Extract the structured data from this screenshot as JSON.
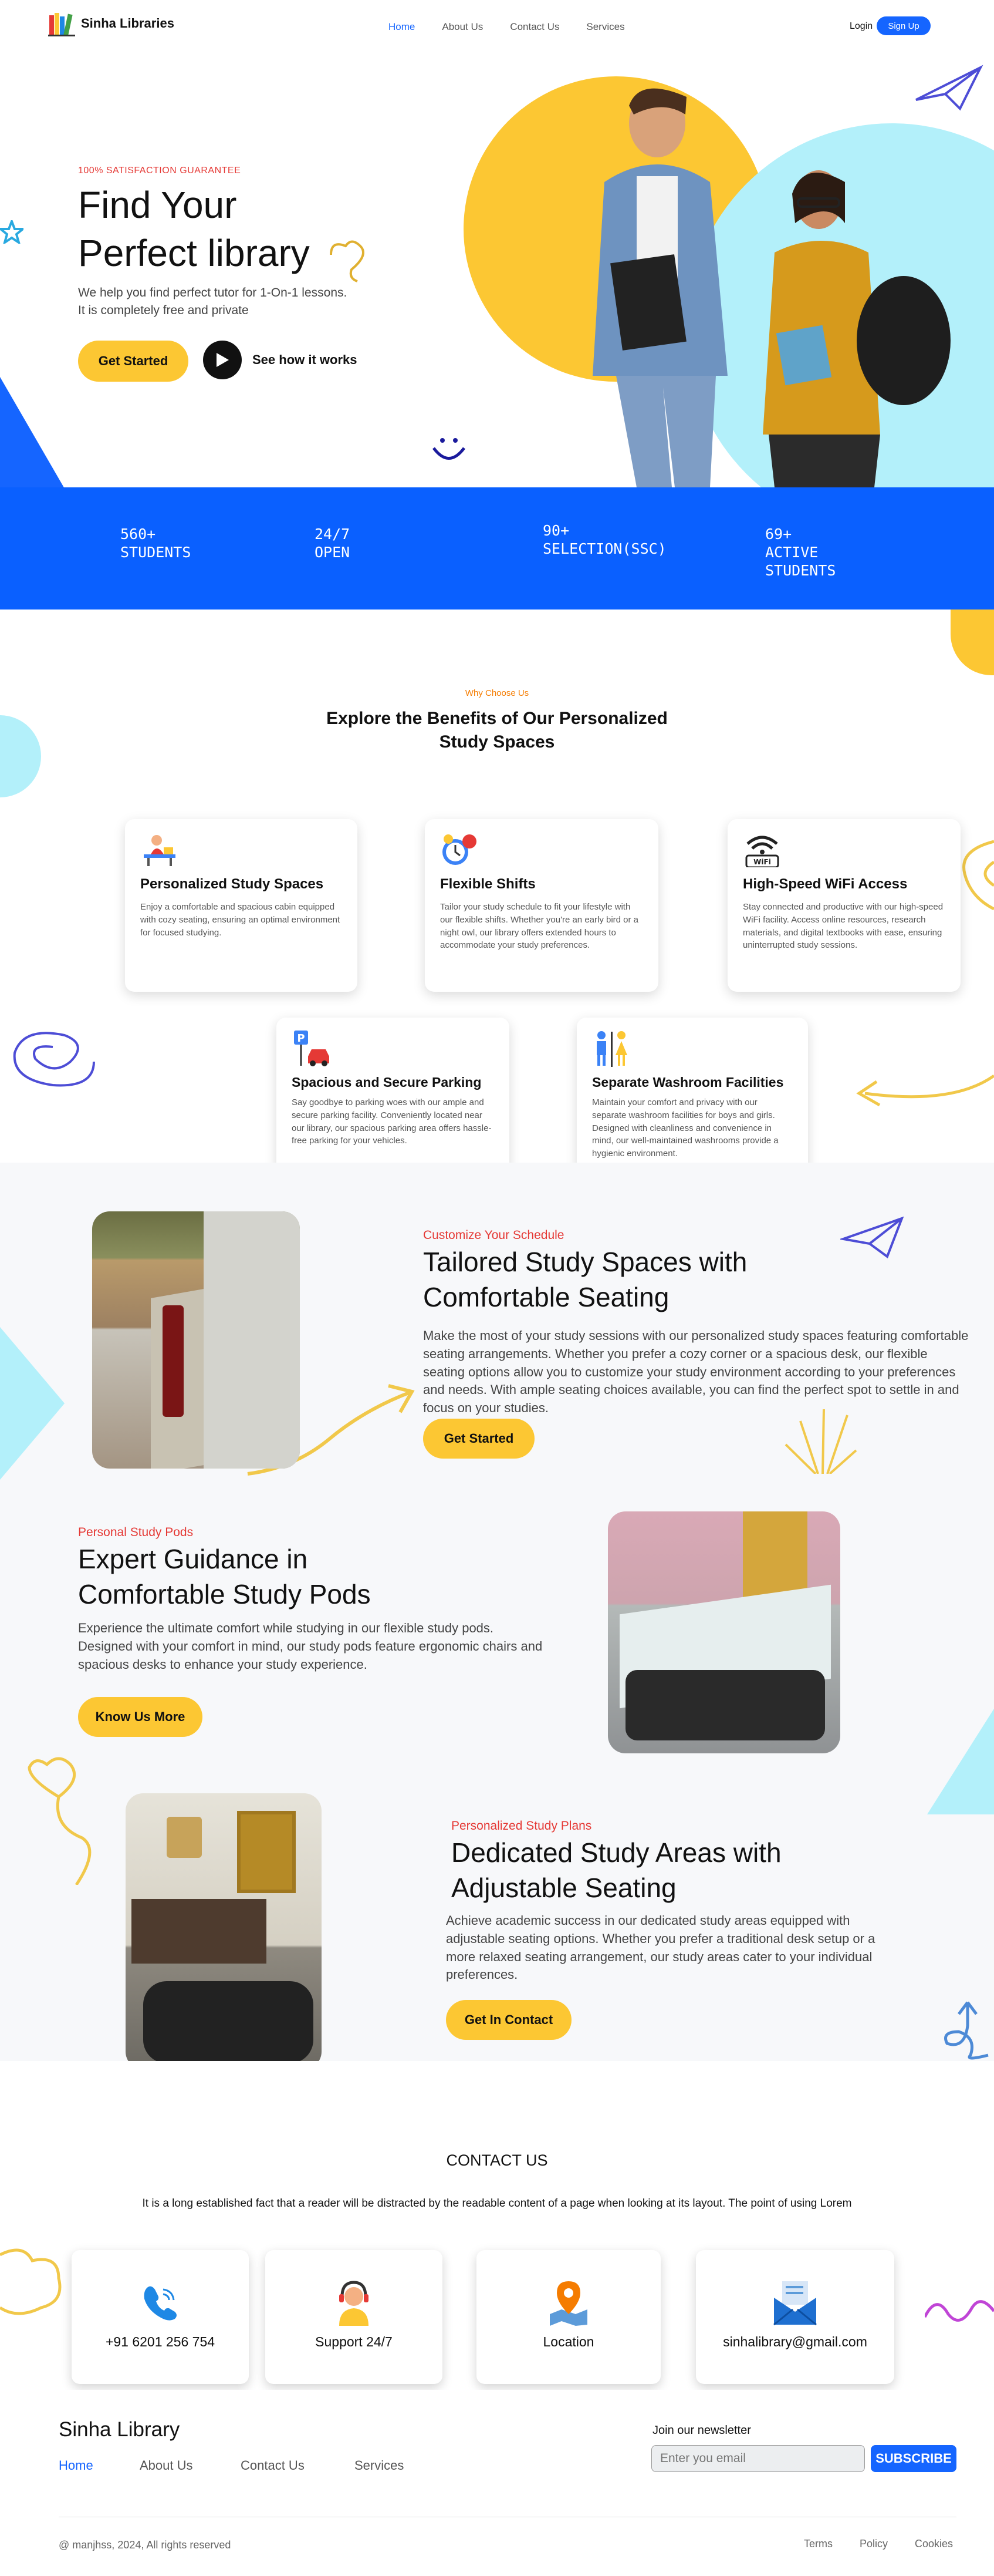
{
  "colors": {
    "accent": "#1565ff",
    "yellow": "#fcc733",
    "cyan": "#b3f0fa",
    "red": "#e53935",
    "orange": "#f57c00"
  },
  "nav": {
    "brand": "Sinha Libraries",
    "links": [
      "Home",
      "About Us",
      "Contact Us",
      "Services"
    ],
    "login": "Login",
    "signup": "Sign Up"
  },
  "hero": {
    "tag": "100% SATISFACTION GUARANTEE",
    "title_line1": "Find Your",
    "title_line2": "Perfect library",
    "subtitle_line1": "We help you find perfect tutor for 1-On-1 lessons.",
    "subtitle_line2": "It is completely free and private",
    "cta": "Get Started",
    "video": "See how it works"
  },
  "stats": [
    {
      "line1": "560+",
      "line2": "STUDENTS"
    },
    {
      "line1": "24/7",
      "line2": "OPEN"
    },
    {
      "line1": "90+",
      "line2": "SELECTION(SSC)"
    },
    {
      "line1": "69+",
      "line2": "ACTIVE",
      "line3": "STUDENTS"
    }
  ],
  "why": {
    "tag": "Why Choose Us",
    "title_line1": "Explore the Benefits of Our Personalized",
    "title_line2": "Study Spaces"
  },
  "features": [
    {
      "icon": "desk-study-icon",
      "title": "Personalized Study Spaces",
      "desc": "Enjoy a comfortable and spacious cabin equipped with cozy seating, ensuring an optimal environment for focused studying."
    },
    {
      "icon": "clock-shift-icon",
      "title": "Flexible Shifts",
      "desc": "Tailor your study schedule to fit your lifestyle with our flexible shifts. Whether you're an early bird or a night owl, our library offers extended hours to accommodate your study preferences."
    },
    {
      "icon": "wifi-icon",
      "title": "High-Speed WiFi Access",
      "desc": "Stay connected and productive with our high-speed WiFi facility. Access online resources, research materials, and digital textbooks with ease, ensuring uninterrupted study sessions."
    },
    {
      "icon": "parking-icon",
      "title": "Spacious and Secure Parking",
      "desc": "Say goodbye to parking woes with our ample and secure parking facility. Conveniently located near our library, our spacious parking area offers hassle-free parking for your vehicles."
    },
    {
      "icon": "washroom-icon",
      "title": "Separate Washroom Facilities",
      "desc": "Maintain your comfort and privacy with our separate washroom facilities for boys and girls. Designed with cleanliness and convenience in mind, our well-maintained washrooms provide a hygienic environment."
    }
  ],
  "blocks": [
    {
      "tag": "Customize Your Schedule",
      "title_line1": "Tailored Study Spaces with",
      "title_line2": "Comfortable Seating",
      "text": "Make the most of your study sessions with our personalized study spaces featuring comfortable seating arrangements. Whether you prefer a cozy corner or a spacious desk, our flexible seating options allow you to customize your study environment according to your preferences and needs. With ample seating choices available, you can find the perfect spot to settle in and focus on your studies.",
      "cta": "Get Started"
    },
    {
      "tag": "Personal Study Pods",
      "title_line1": "Expert Guidance in",
      "title_line2": "Comfortable Study Pods",
      "text": "Experience the ultimate comfort while studying in our flexible study pods. Designed with your comfort in mind, our study pods feature ergonomic chairs and spacious desks to enhance your study experience.",
      "cta": "Know Us More"
    },
    {
      "tag": "Personalized Study Plans",
      "title_line1": "Dedicated Study Areas with",
      "title_line2": "Adjustable Seating",
      "text": "Achieve academic success in our dedicated study areas equipped with adjustable seating options. Whether you prefer a traditional desk setup or a more relaxed seating arrangement, our study areas cater to your individual preferences.",
      "cta": "Get In Contact"
    }
  ],
  "contact": {
    "title": "CONTACT US",
    "text": "It is a long established fact that a reader will be distracted by the readable content of a page when looking at its layout. The point of using Lorem",
    "cards": [
      {
        "icon": "phone-icon",
        "label": "+91 6201 256 754"
      },
      {
        "icon": "support-agent-icon",
        "label": "Support 24/7"
      },
      {
        "icon": "location-pin-icon",
        "label": "Location"
      },
      {
        "icon": "email-icon",
        "label": "sinhalibrary@gmail.com"
      }
    ]
  },
  "footer": {
    "brand": "Sinha Library",
    "links": [
      "Home",
      "About Us",
      "Contact Us",
      "Services"
    ],
    "newsletter_label": "Join our newsletter",
    "email_placeholder": "Enter you email",
    "subscribe": "SUBSCRIBE",
    "copyright": "@ manjhss, 2024, All rights reserved",
    "legal": [
      "Terms",
      "Policy",
      "Cookies"
    ]
  }
}
